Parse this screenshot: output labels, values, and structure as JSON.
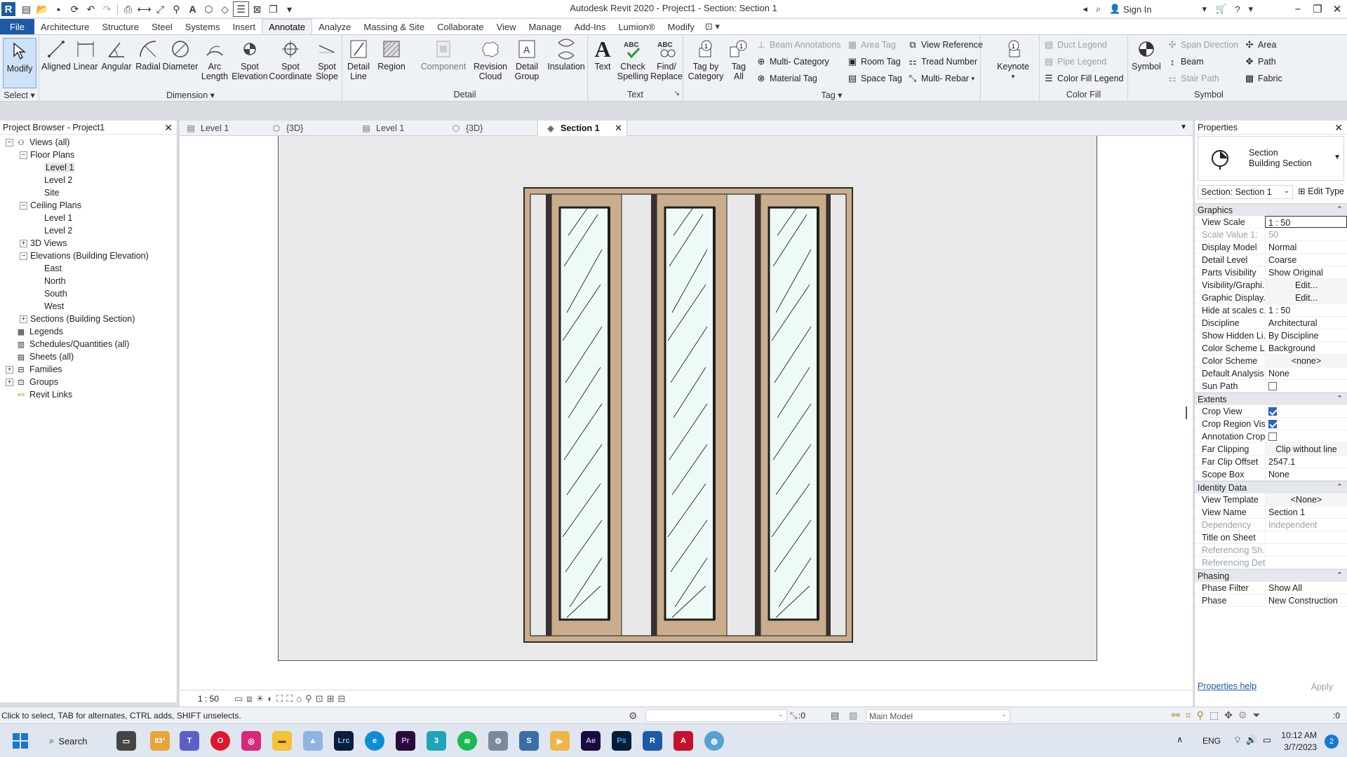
{
  "app": {
    "title": "Autodesk Revit 2020 - Project1 - Section: Section 1",
    "sign_in": "Sign In"
  },
  "ribbon_tabs": [
    "File",
    "Architecture",
    "Structure",
    "Steel",
    "Systems",
    "Insert",
    "Annotate",
    "Analyze",
    "Massing & Site",
    "Collaborate",
    "View",
    "Manage",
    "Add-Ins",
    "Lumion®",
    "Modify"
  ],
  "active_tab": "Annotate",
  "ribbon": {
    "select": {
      "label": "Select",
      "modify": "Modify"
    },
    "dimension": {
      "label": "Dimension",
      "buttons": [
        "Aligned",
        "Linear",
        "Angular",
        "Radial",
        "Diameter",
        "Arc Length",
        "Spot Elevation",
        "Spot Coordinate",
        "Spot Slope"
      ]
    },
    "detail": {
      "label": "Detail",
      "buttons": [
        "Detail Line",
        "Region",
        "Component",
        "Revision Cloud",
        "Detail Group",
        "Insulation"
      ]
    },
    "text": {
      "label": "Text",
      "buttons": [
        "Text",
        "Check Spelling",
        "Find/ Replace"
      ]
    },
    "tag": {
      "label": "Tag",
      "big": [
        "Tag by Category",
        "Tag All"
      ],
      "small": [
        "Beam Annotations",
        "Multi- Category",
        "Material Tag",
        "Area Tag",
        "Room Tag",
        "Space Tag",
        "View Reference",
        "Tread Number",
        "Multi- Rebar"
      ]
    },
    "keynote": "Keynote",
    "color_fill": {
      "label": "Color Fill",
      "items": [
        "Duct Legend",
        "Pipe Legend",
        "Color Fill Legend"
      ]
    },
    "symbol": {
      "label": "Symbol",
      "big": "Symbol",
      "items": [
        "Span Direction",
        "Beam",
        "Stair Path",
        "Area",
        "Path",
        "Fabric"
      ]
    }
  },
  "browser": {
    "title": "Project Browser - Project1",
    "nodes": [
      {
        "label": "Views (all)",
        "level": 0,
        "toggle": "−",
        "icon": "views"
      },
      {
        "label": "Floor Plans",
        "level": 1,
        "toggle": "−"
      },
      {
        "label": "Level 1",
        "level": 2,
        "selected": true
      },
      {
        "label": "Level 2",
        "level": 2
      },
      {
        "label": "Site",
        "level": 2
      },
      {
        "label": "Ceiling Plans",
        "level": 1,
        "toggle": "−"
      },
      {
        "label": "Level 1",
        "level": 2
      },
      {
        "label": "Level 2",
        "level": 2
      },
      {
        "label": "3D Views",
        "level": 1,
        "toggle": "+"
      },
      {
        "label": "Elevations (Building Elevation)",
        "level": 1,
        "toggle": "−"
      },
      {
        "label": "East",
        "level": 2
      },
      {
        "label": "North",
        "level": 2
      },
      {
        "label": "South",
        "level": 2
      },
      {
        "label": "West",
        "level": 2
      },
      {
        "label": "Sections (Building Section)",
        "level": 1,
        "toggle": "+"
      },
      {
        "label": "Legends",
        "level": 0,
        "icon": "legend"
      },
      {
        "label": "Schedules/Quantities (all)",
        "level": 0,
        "icon": "schedule"
      },
      {
        "label": "Sheets (all)",
        "level": 0,
        "icon": "sheet"
      },
      {
        "label": "Families",
        "level": 0,
        "toggle": "+",
        "icon": "family"
      },
      {
        "label": "Groups",
        "level": 0,
        "toggle": "+",
        "icon": "group"
      },
      {
        "label": "Revit Links",
        "level": 0,
        "icon": "link"
      }
    ]
  },
  "view_tabs": [
    {
      "label": "Level 1",
      "icon": "plan"
    },
    {
      "label": "{3D}",
      "icon": "3d"
    },
    {
      "label": "Level 1",
      "icon": "plan"
    },
    {
      "label": "{3D}",
      "icon": "3d"
    },
    {
      "label": "Section 1",
      "icon": "section",
      "active": true
    }
  ],
  "view_bar": {
    "scale": "1 : 50"
  },
  "properties": {
    "title": "Properties",
    "type_family": "Section",
    "type_name": "Building Section",
    "instance": "Section: Section 1",
    "edit_type": "Edit Type",
    "help": "Properties help",
    "apply": "Apply",
    "sections": [
      {
        "name": "Graphics",
        "rows": [
          {
            "k": "View Scale",
            "v": "1 : 50",
            "editing": true
          },
          {
            "k": "Scale Value    1:",
            "v": "50",
            "dim": true
          },
          {
            "k": "Display Model",
            "v": "Normal"
          },
          {
            "k": "Detail Level",
            "v": "Coarse"
          },
          {
            "k": "Parts Visibility",
            "v": "Show Original"
          },
          {
            "k": "Visibility/Graphi...",
            "v": "Edit...",
            "btn": true
          },
          {
            "k": "Graphic Display...",
            "v": "Edit...",
            "btn": true
          },
          {
            "k": "Hide at scales c...",
            "v": "1 : 50"
          },
          {
            "k": "Discipline",
            "v": "Architectural"
          },
          {
            "k": "Show Hidden Li...",
            "v": "By Discipline"
          },
          {
            "k": "Color Scheme L...",
            "v": "Background"
          },
          {
            "k": "Color Scheme",
            "v": "<none>",
            "btn": true
          },
          {
            "k": "Default Analysis...",
            "v": "None"
          },
          {
            "k": "Sun Path",
            "check": false
          }
        ]
      },
      {
        "name": "Extents",
        "rows": [
          {
            "k": "Crop View",
            "check": true
          },
          {
            "k": "Crop Region Vis...",
            "check": true
          },
          {
            "k": "Annotation Crop",
            "check": false
          },
          {
            "k": "Far Clipping",
            "v": "Clip without line",
            "btn": true
          },
          {
            "k": "Far Clip Offset",
            "v": "2547.1"
          },
          {
            "k": "Scope Box",
            "v": "None"
          }
        ]
      },
      {
        "name": "Identity Data",
        "rows": [
          {
            "k": "View Template",
            "v": "<None>",
            "btn": true
          },
          {
            "k": "View Name",
            "v": "Section 1"
          },
          {
            "k": "Dependency",
            "v": "Independent",
            "dim": true
          },
          {
            "k": "Title on Sheet",
            "v": ""
          },
          {
            "k": "Referencing Sh...",
            "v": "",
            "dim": true
          },
          {
            "k": "Referencing Det...",
            "v": "",
            "dim": true
          }
        ]
      },
      {
        "name": "Phasing",
        "rows": [
          {
            "k": "Phase Filter",
            "v": "Show All"
          },
          {
            "k": "Phase",
            "v": "New Construction"
          }
        ]
      }
    ]
  },
  "status": {
    "message": "Click to select, TAB for alternates, CTRL adds, SHIFT unselects.",
    "zero": ":0",
    "model": "Main Model",
    "filter": ":0"
  },
  "taskbar": {
    "search": "Search",
    "weather": "83°",
    "lang": "ENG",
    "time": "10:12 AM",
    "date": "3/7/2023",
    "notifications": "2"
  },
  "colors": {
    "accent": "#1c5aa8",
    "frame_wood": "#c9ad8c",
    "glass": "#eefaf8",
    "sheet_bg": "#e9e9e9"
  }
}
